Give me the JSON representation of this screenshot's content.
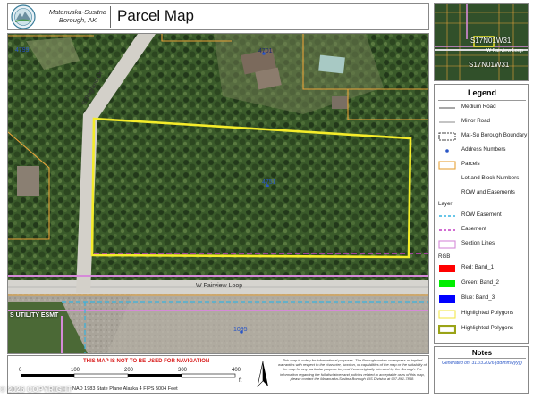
{
  "header": {
    "borough_line1": "Matanuska-Susitna",
    "borough_line2": "Borough, AK",
    "title": "Parcel Map"
  },
  "map": {
    "parcel_numbers": [
      "4799",
      "4701",
      "4751",
      "1095"
    ],
    "road_labels": [
      "S Ragland Dr",
      "W Fairview Loop"
    ],
    "easement_label": "S UTILITY ESMT"
  },
  "inset": {
    "section_labels": [
      "S17N01W31",
      "S17N01W31"
    ],
    "road_label": "W Fairview Loop"
  },
  "bottom": {
    "warning": "THIS MAP IS NOT TO BE USED FOR NAVIGATION",
    "scale_ticks": [
      "0",
      "100",
      "200",
      "300",
      "400"
    ],
    "scale_unit": "ft",
    "projection": "NAD 1983 State Plane Alaska 4 FIPS 5004 Feet",
    "disclaimer": "This map is solely for informational purposes. The Borough makes no express or implied warranties with respect to the character, function, or capabilities of the map or the suitability of the map for any particular purpose beyond those originally intended by the Borough. For information regarding the full disclaimer and policies related to acceptable uses of this map, please contact the Matanuska-Susitna Borough GIS Division at 907-861-7858.",
    "copyright": "© 2026 COPYRIGHT"
  },
  "legend": {
    "title": "Legend",
    "items": [
      {
        "label": "Medium Road",
        "kind": "line",
        "color": "#8a8a8a"
      },
      {
        "label": "Minor Road",
        "kind": "line",
        "color": "#b0b0b0"
      },
      {
        "label": "Mat-Su Borough Boundary",
        "kind": "dashbox",
        "color": "#444444"
      },
      {
        "label": "Address Numbers",
        "kind": "dot",
        "color": "#2a56c6"
      },
      {
        "label": "Parcels",
        "kind": "box",
        "color": "#e8a33a"
      },
      {
        "label": "Lot and Block Numbers",
        "kind": "none",
        "color": ""
      },
      {
        "label": "ROW and Easements",
        "kind": "none",
        "color": ""
      }
    ],
    "layer_heading": "Layer",
    "layer_items": [
      {
        "label": "ROW Easement",
        "kind": "dashline",
        "color": "#36b3e0"
      },
      {
        "label": "Easement",
        "kind": "dashline",
        "color": "#c43cc4"
      },
      {
        "label": "Section Lines",
        "kind": "box",
        "color": "#d58ad8"
      }
    ],
    "rgb_heading": "RGB",
    "rgb_items": [
      {
        "label": "Red:   Band_1",
        "kind": "fill",
        "color": "#ff0000"
      },
      {
        "label": "Green: Band_2",
        "kind": "fill",
        "color": "#00ee00"
      },
      {
        "label": "Blue:  Band_3",
        "kind": "fill",
        "color": "#0000ff"
      },
      {
        "label": "Highlighted Polygons",
        "kind": "box",
        "color": "#f2e84a"
      },
      {
        "label": "Highlighted Polygons",
        "kind": "thickbox",
        "color": "#9aa317"
      }
    ]
  },
  "notes": {
    "title": "Notes",
    "generated": "Generated on: 31.03.2026 (dd/mm/yyyy)"
  },
  "colors": {
    "parcel_highlight": "#f4ec2a",
    "parcel_line": "#e8a33a",
    "easement": "#c43cc4",
    "row_easement": "#36b3e0",
    "address": "#2a56c6",
    "forest": "#2f4a22"
  }
}
